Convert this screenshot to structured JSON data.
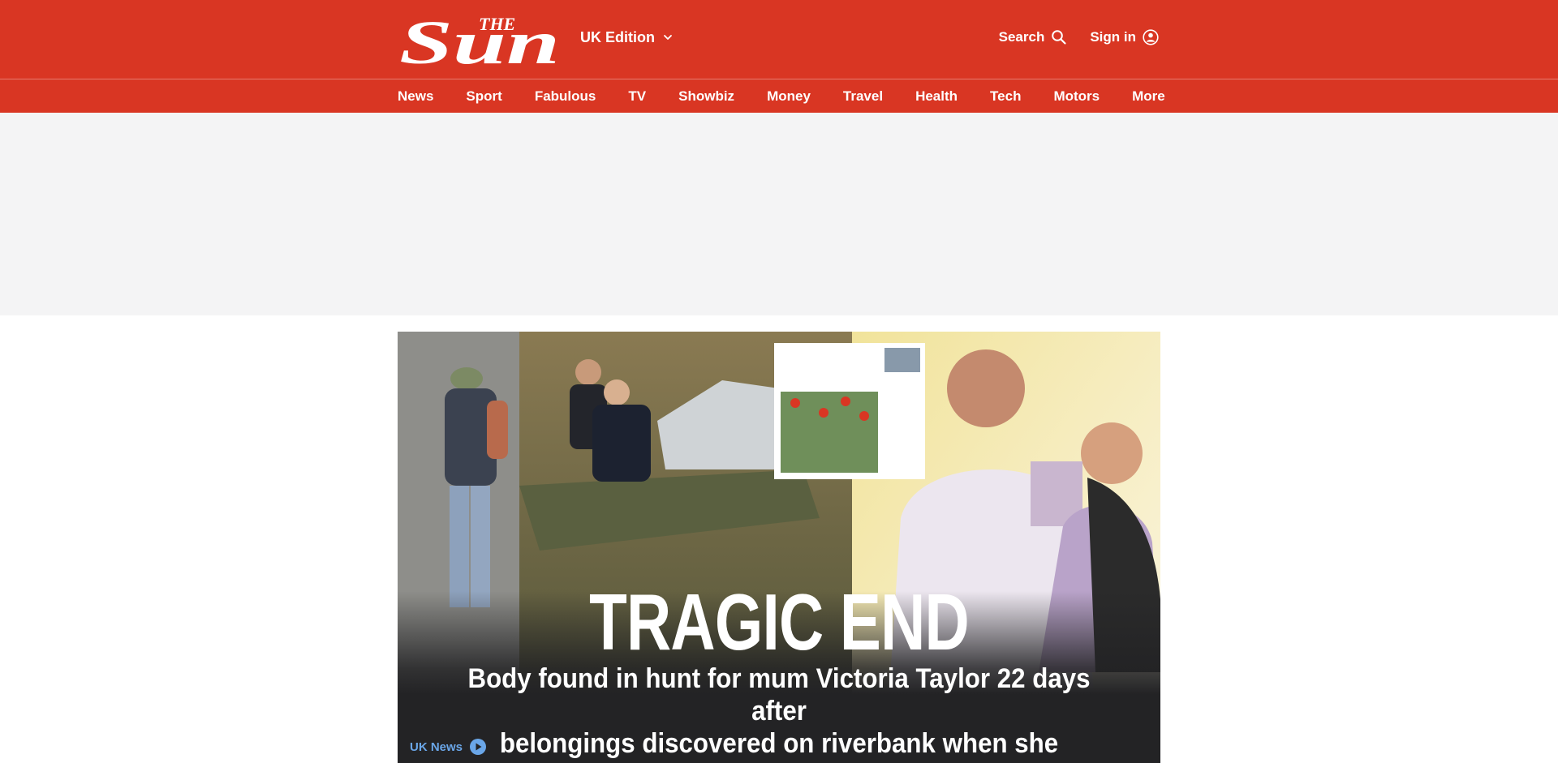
{
  "brand": {
    "logo_small": "THE",
    "logo_large": "Sun"
  },
  "header": {
    "edition_label": "UK Edition",
    "search_label": "Search",
    "signin_label": "Sign in"
  },
  "nav": {
    "items": [
      {
        "label": "News"
      },
      {
        "label": "Sport"
      },
      {
        "label": "Fabulous"
      },
      {
        "label": "TV"
      },
      {
        "label": "Showbiz"
      },
      {
        "label": "Money"
      },
      {
        "label": "Travel"
      },
      {
        "label": "Health"
      },
      {
        "label": "Tech"
      },
      {
        "label": "Motors"
      },
      {
        "label": "More"
      }
    ]
  },
  "hero": {
    "kicker": "TRAGIC END",
    "headline_line1": "Body found in hunt for mum Victoria Taylor 22 days after",
    "headline_line2": "belongings discovered on riverbank when she vanished",
    "section": "UK News"
  },
  "icons": {
    "edition": "chevron-down-icon",
    "search": "search-icon",
    "signin": "user-icon",
    "video": "play-icon"
  },
  "colors": {
    "brand_red": "#d93623",
    "ad_background": "#f4f4f5",
    "hero_dark": "#232325",
    "section_blue": "#6aa6e8"
  }
}
